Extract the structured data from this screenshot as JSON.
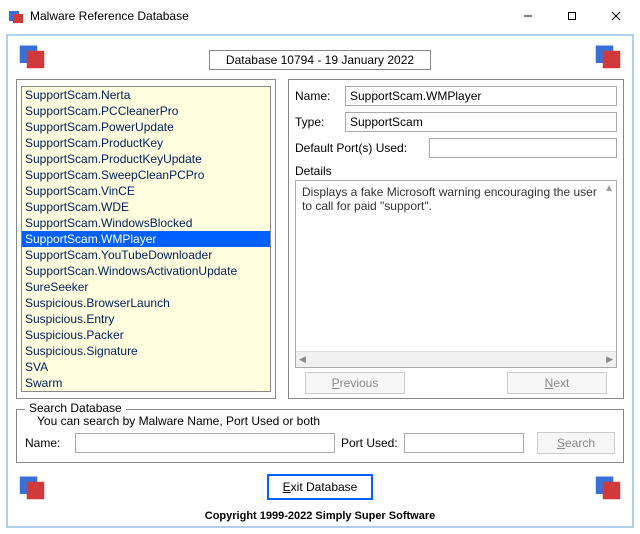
{
  "window": {
    "title": "Malware Reference Database"
  },
  "header": {
    "database_info": "Database 10794 - 19 January 2022"
  },
  "list": {
    "items": [
      "SupportScam.Nerta",
      "SupportScam.PCCleanerPro",
      "SupportScam.PowerUpdate",
      "SupportScam.ProductKey",
      "SupportScam.ProductKeyUpdate",
      "SupportScam.SweepCleanPCPro",
      "SupportScam.VinCE",
      "SupportScam.WDE",
      "SupportScam.WindowsBlocked",
      "SupportScam.WMPlayer",
      "SupportScam.YouTubeDownloader",
      "SupportScan.WindowsActivationUpdate",
      "SureSeeker",
      "Suspicious.BrowserLaunch",
      "Suspicious.Entry",
      "Suspicious.Packer",
      "Suspicious.Signature",
      "SVA",
      "Swarm"
    ],
    "selected_index": 9
  },
  "detail": {
    "labels": {
      "name": "Name:",
      "type": "Type:",
      "ports": "Default Port(s) Used:",
      "details": "Details"
    },
    "name": "SupportScam.WMPlayer",
    "type": "SupportScam",
    "ports": "",
    "details": "Displays a fake Microsoft warning encouraging the user to call for paid \"support\"."
  },
  "nav": {
    "previous": "Previous",
    "next": "Next"
  },
  "search": {
    "legend": "Search Database",
    "hint": "You can search by Malware Name, Port Used or both",
    "name_label": "Name:",
    "port_label": "Port Used:",
    "name_value": "",
    "port_value": "",
    "button": "Search"
  },
  "footer": {
    "exit": "Exit Database",
    "copyright": "Copyright 1999-2022 Simply Super Software"
  }
}
